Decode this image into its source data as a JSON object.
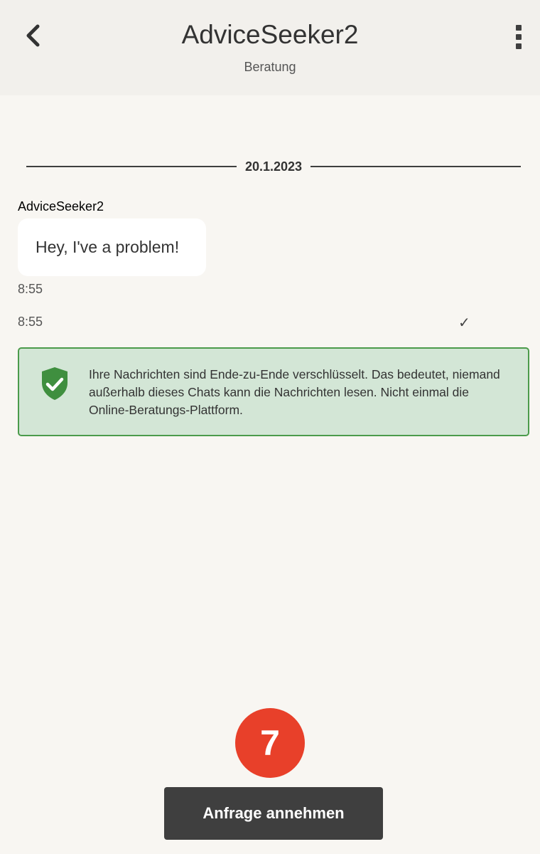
{
  "header": {
    "title": "AdviceSeeker2",
    "subtitle": "Beratung"
  },
  "conversation": {
    "date": "20.1.2023",
    "messages": [
      {
        "sender": "AdviceSeeker2",
        "text": "Hey, I've a problem!",
        "time": "8:55"
      }
    ],
    "system_time": "8:55",
    "read_mark": "✓"
  },
  "notice": {
    "text": "Ihre Nachrichten sind Ende-zu-Ende verschlüsselt. Das bedeutet, niemand außerhalb dieses Chats kann die Nachrichten lesen. Nicht einmal die Online-Beratungs-Plattform.",
    "icon": "shield-check-icon"
  },
  "footer": {
    "badge": "7",
    "accept_label": "Anfrage annehmen"
  },
  "colors": {
    "background": "#f8f6f2",
    "header_bg": "#f2f0ec",
    "notice_bg": "#d3e6d6",
    "notice_border": "#4b9b4b",
    "shield": "#3f8f3f",
    "badge": "#e8402a",
    "button": "#3f3f3f"
  }
}
